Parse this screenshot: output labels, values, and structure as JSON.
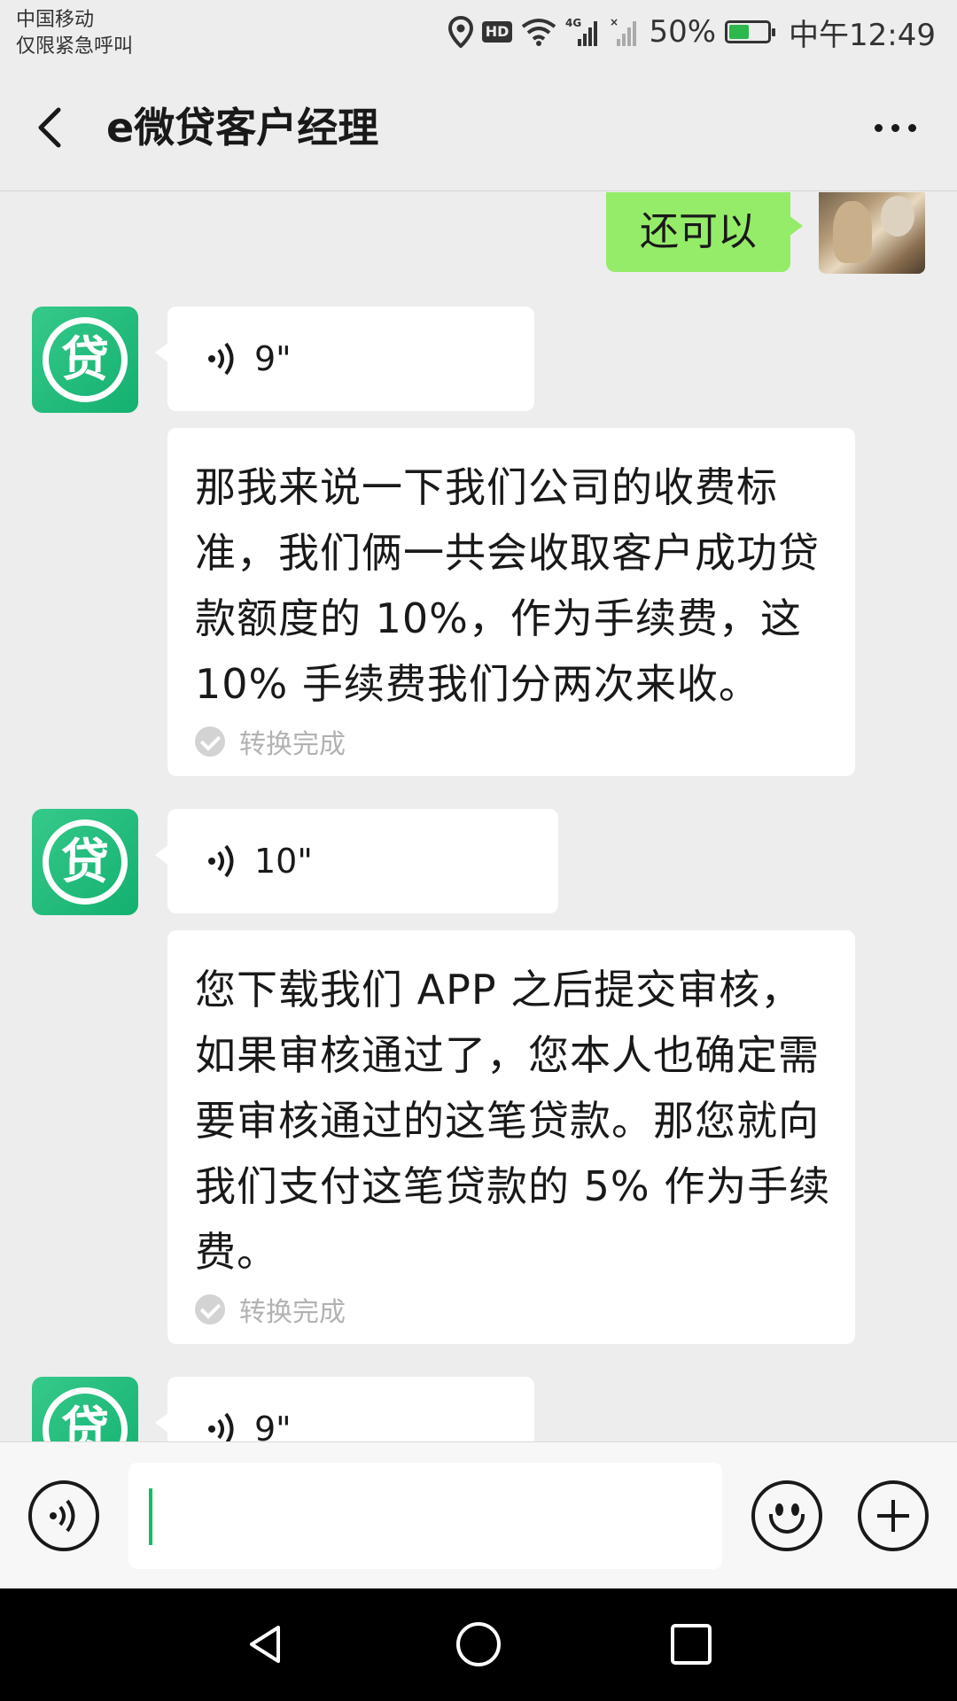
{
  "status_bar": {
    "carrier_line1": "中国移动",
    "carrier_line2": "仅限紧急呼叫",
    "network": "4G",
    "battery": "50%",
    "battery_level": 0.5,
    "time": "中午12:49",
    "hd_label": "HD",
    "icons": [
      "location-icon",
      "hd-icon",
      "wifi-icon",
      "signal-icon",
      "no-signal-icon",
      "battery-icon"
    ]
  },
  "header": {
    "title": "e微贷客户经理",
    "back_icon": "chevron-left-icon",
    "more_icon": "more-dots-icon"
  },
  "messages": {
    "own_text": "还可以",
    "bot_avatar_char": "贷",
    "voice_1_duration": "9\"",
    "transcript_1": "那我来说一下我们公司的收费标准，我们俩一共会收取客户成功贷款额度的 10%，作为手续费，这 10% 手续费我们分两次来收。",
    "voice_2_duration": "10\"",
    "transcript_2": "您下载我们 APP 之后提交审核，如果审核通过了，您本人也确定需要审核通过的这笔贷款。那您就向我们支付这笔贷款的 5% 作为手续费。",
    "voice_3_duration": "9\"",
    "transcript_status": "转换完成"
  },
  "input_bar": {
    "value": "",
    "icons": [
      "voice-toggle-icon",
      "emoji-icon",
      "plus-icon"
    ]
  },
  "colors": {
    "own_bubble": "#95ec69",
    "background": "#ededed",
    "bot_avatar": "#13b070",
    "accent": "#07c160"
  }
}
